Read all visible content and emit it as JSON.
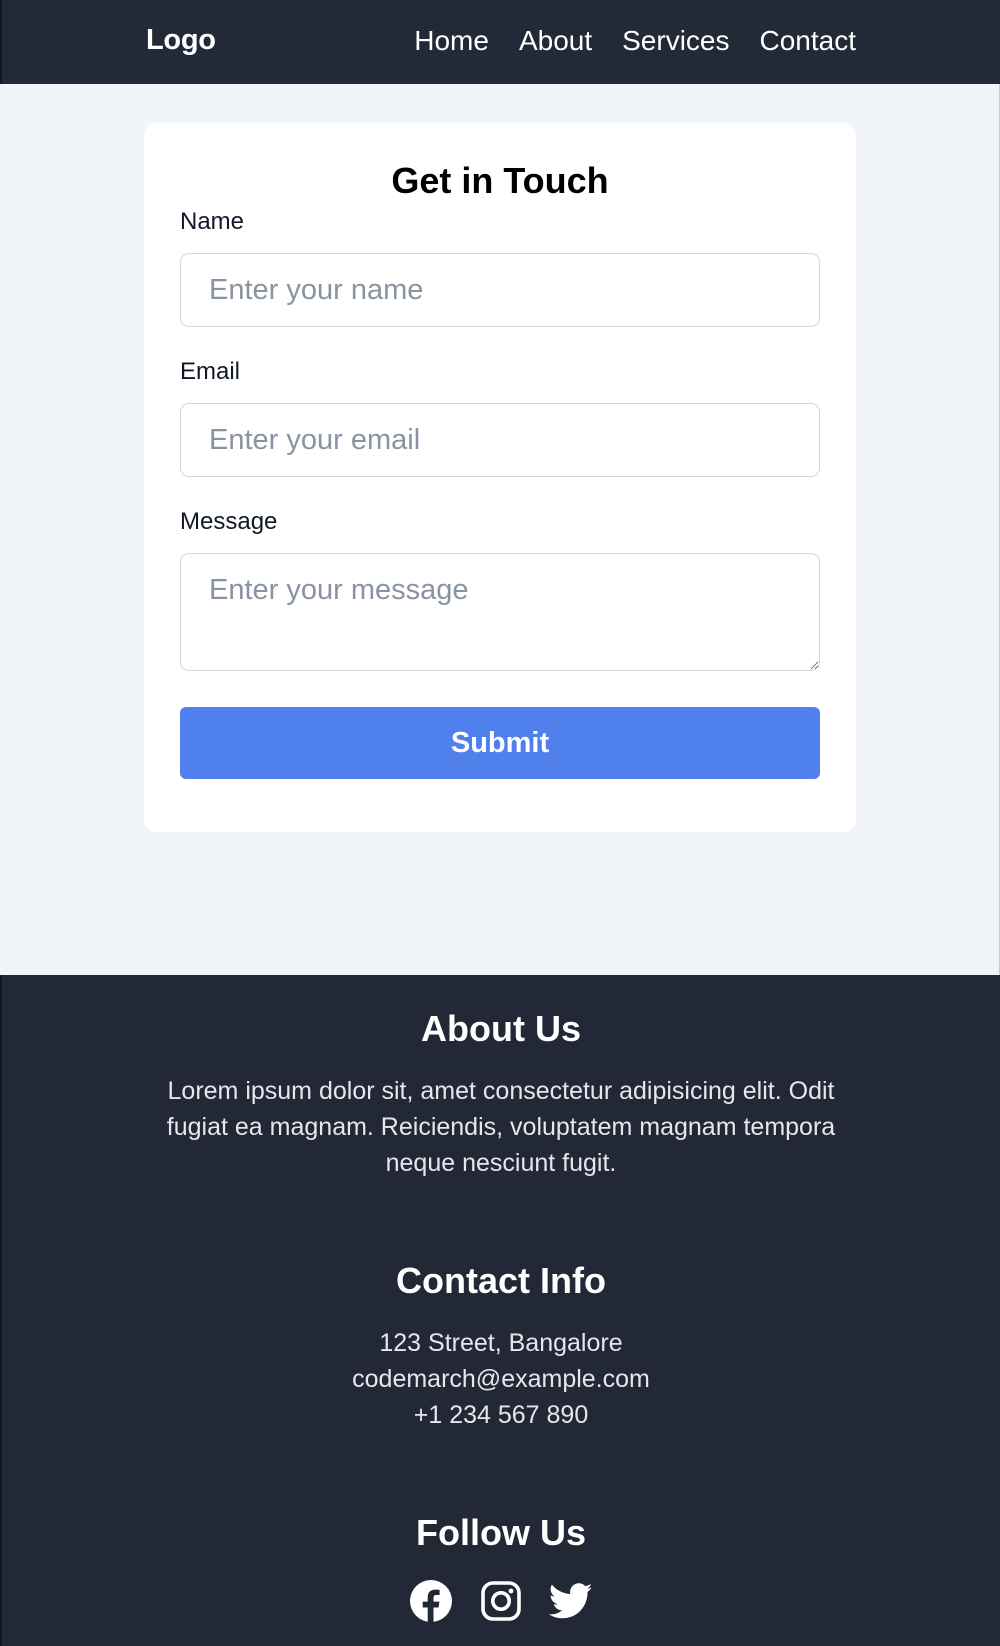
{
  "header": {
    "logo": "Logo",
    "nav": [
      "Home",
      "About",
      "Services",
      "Contact"
    ]
  },
  "form": {
    "title": "Get in Touch",
    "name_label": "Name",
    "name_placeholder": "Enter your name",
    "email_label": "Email",
    "email_placeholder": "Enter your email",
    "message_label": "Message",
    "message_placeholder": "Enter your message",
    "submit_label": "Submit"
  },
  "footer": {
    "about_heading": "About Us",
    "about_text": "Lorem ipsum dolor sit, amet consectetur adipisicing elit. Odit fugiat ea magnam. Reiciendis, voluptatem magnam tempora neque nesciunt fugit.",
    "contact_heading": "Contact Info",
    "address": "123 Street, Bangalore",
    "email": "codemarch@example.com",
    "phone": "+1 234 567 890",
    "follow_heading": "Follow Us",
    "social_icons": [
      "facebook-icon",
      "instagram-icon",
      "twitter-icon"
    ]
  },
  "colors": {
    "header_bg": "#232a37",
    "footer_bg": "#222836",
    "page_bg": "#f1f5f9",
    "accent": "#4f80ec"
  }
}
